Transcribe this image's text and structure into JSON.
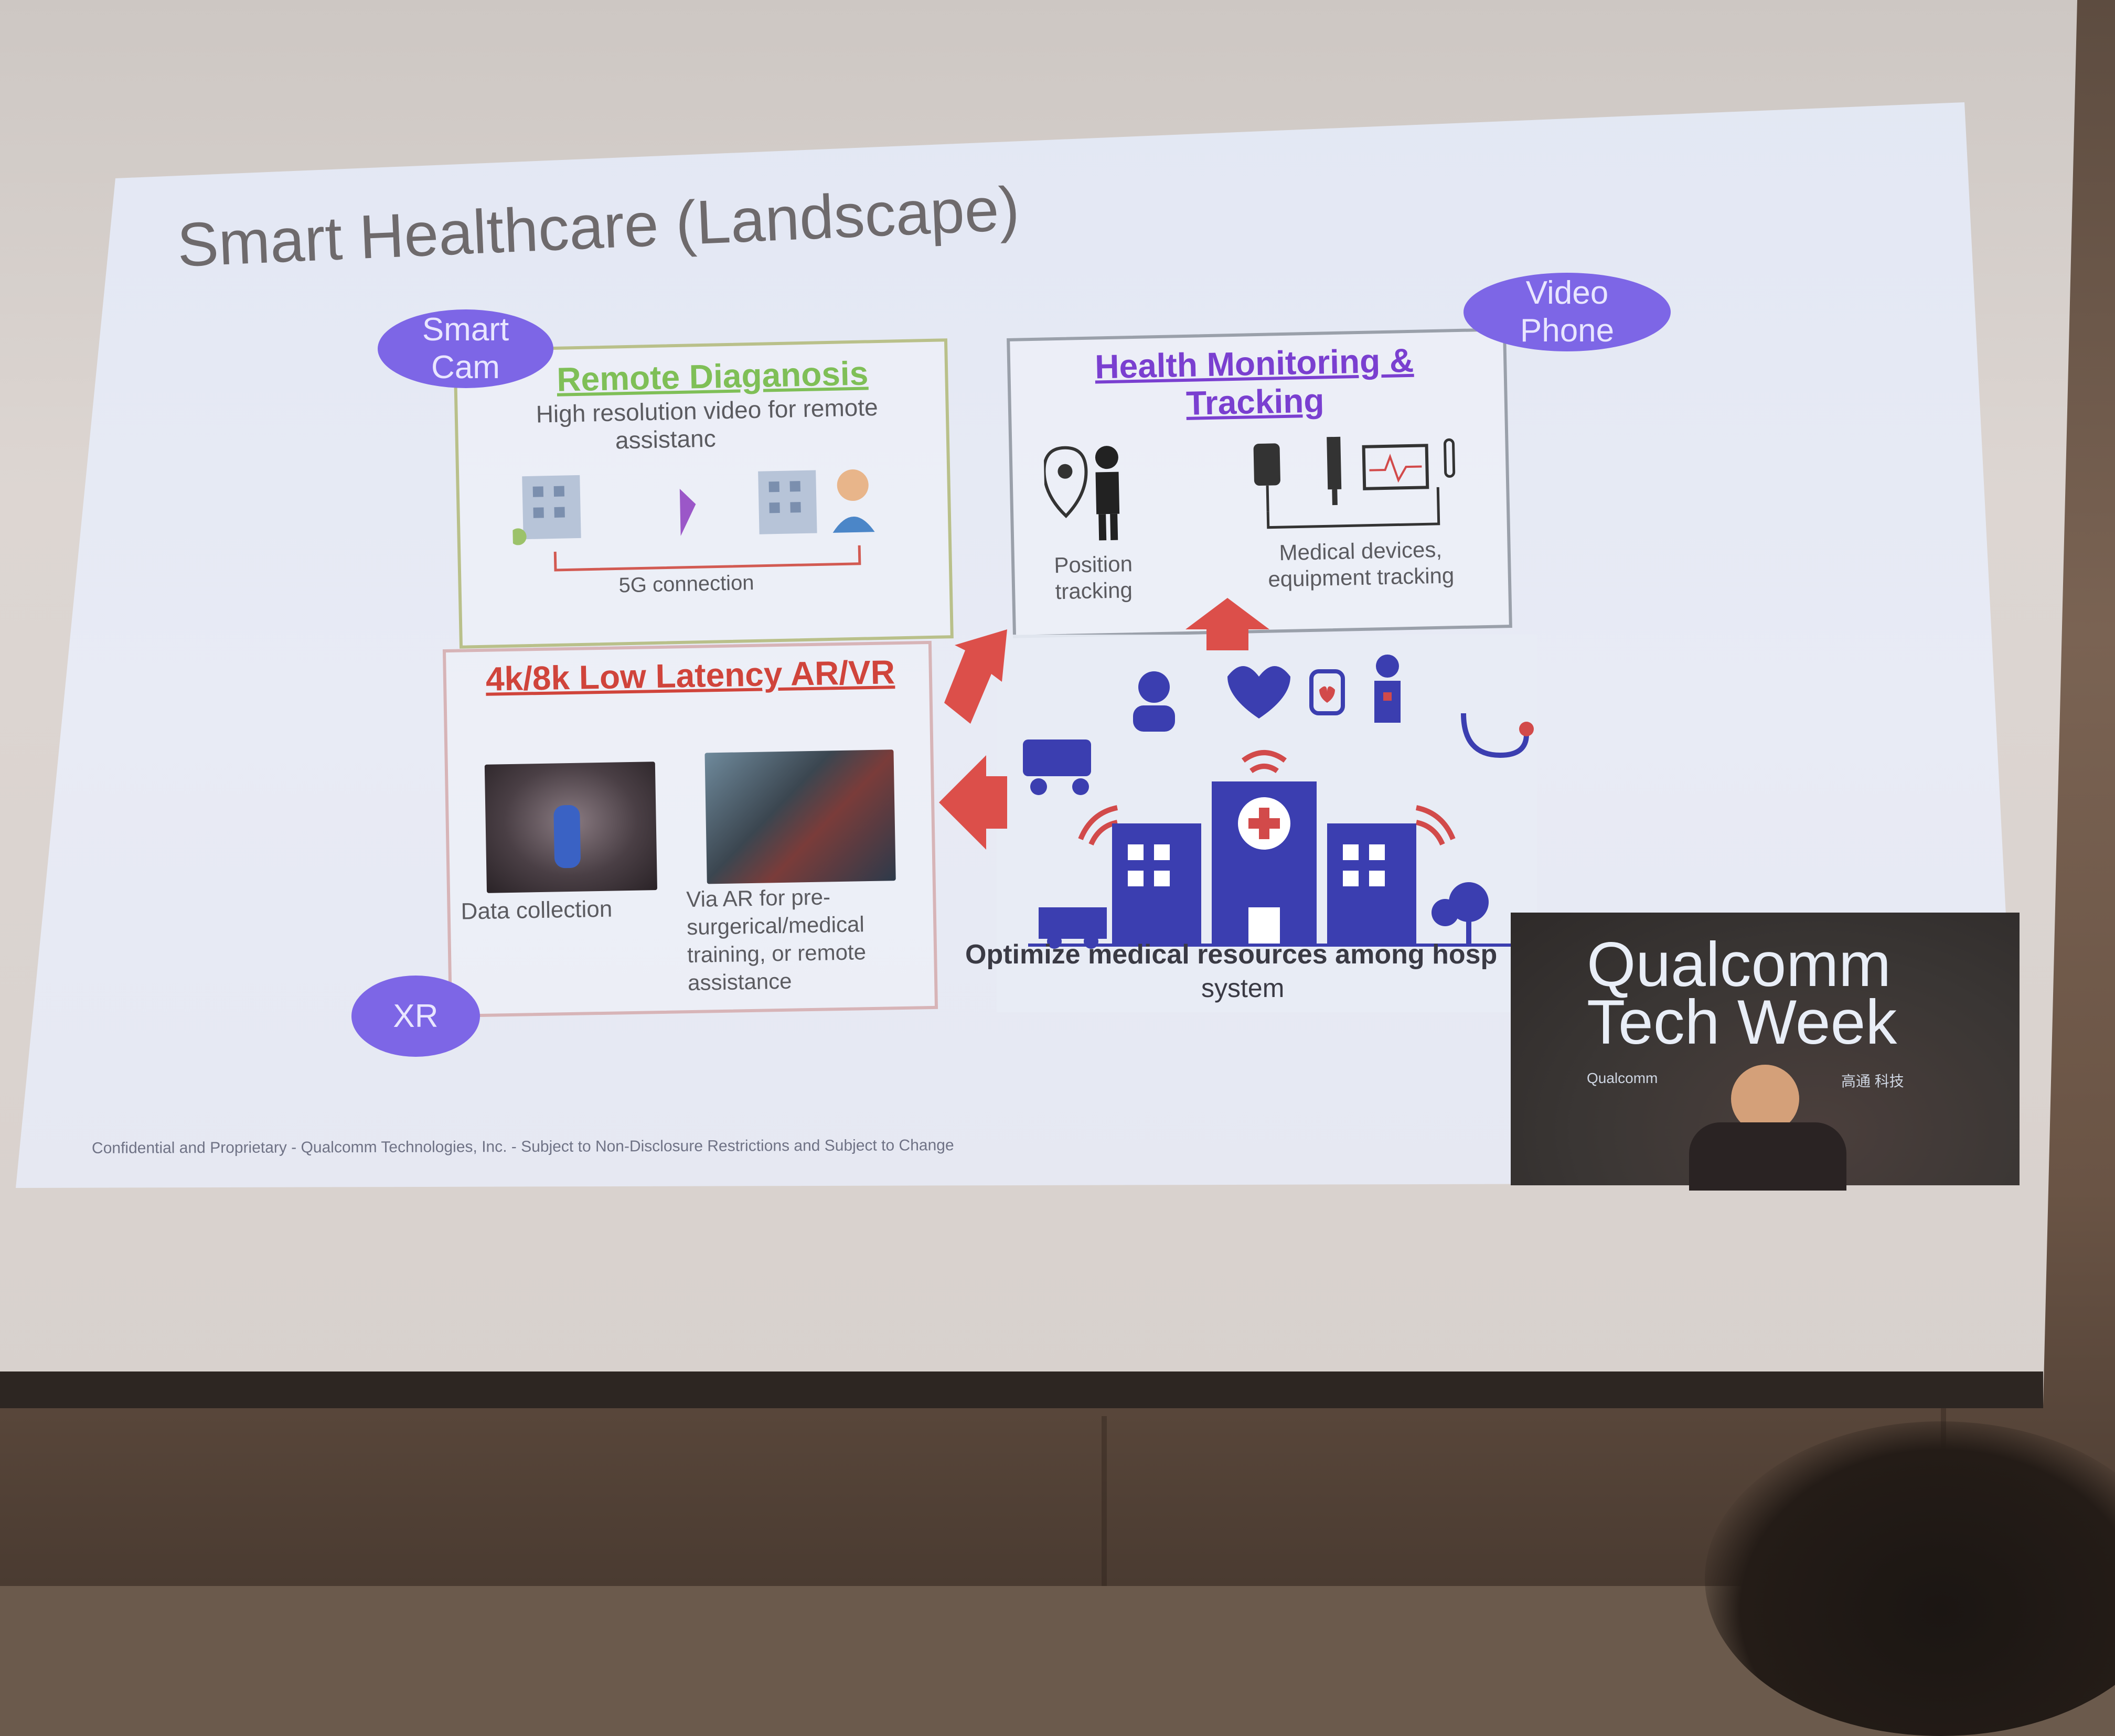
{
  "slide": {
    "title": "Smart Healthcare (Landscape)",
    "ovals": {
      "smart_cam_line1": "Smart",
      "smart_cam_line2": "Cam",
      "video_phone_line1": "Video",
      "video_phone_line2": "Phone",
      "xr": "XR"
    },
    "remote": {
      "title": "Remote Diaganosis",
      "subtitle_line1": "High resolution video for remote",
      "subtitle_line2": "assistanc",
      "connection": "5G connection"
    },
    "health": {
      "title_line1": "Health Monitoring &",
      "title_line2": "Tracking",
      "position_line1": "Position",
      "position_line2": "tracking",
      "devices_line1": "Medical devices,",
      "devices_line2": "equipment tracking"
    },
    "arvr": {
      "title": "4k/8k Low Latency AR/VR",
      "data_collection": "Data collection",
      "ar_line1": "Via AR for pre-",
      "ar_line2": "surgerical/medical",
      "ar_line3": "training, or remote",
      "ar_line4": "assistance"
    },
    "hospital": {
      "caption_line1": "Optimize medical resources among hosp",
      "caption_line2": "system"
    },
    "footer": "Confidential and Proprietary - Qualcomm Technologies, Inc. - Subject to Non-Disclosure Restrictions and Subject to Change"
  },
  "overlay": {
    "line1": "Qualcomm",
    "line2": "Tech Week",
    "small_left": "Qualcomm",
    "small_right": "高通 科技"
  },
  "colors": {
    "oval": "#7d66e6",
    "remote_title": "#7fbf57",
    "health_title": "#7a3fd0",
    "arvr_title": "#d0443b",
    "arrow": "#dc4f4a",
    "hospital": "#3b3eb0"
  }
}
